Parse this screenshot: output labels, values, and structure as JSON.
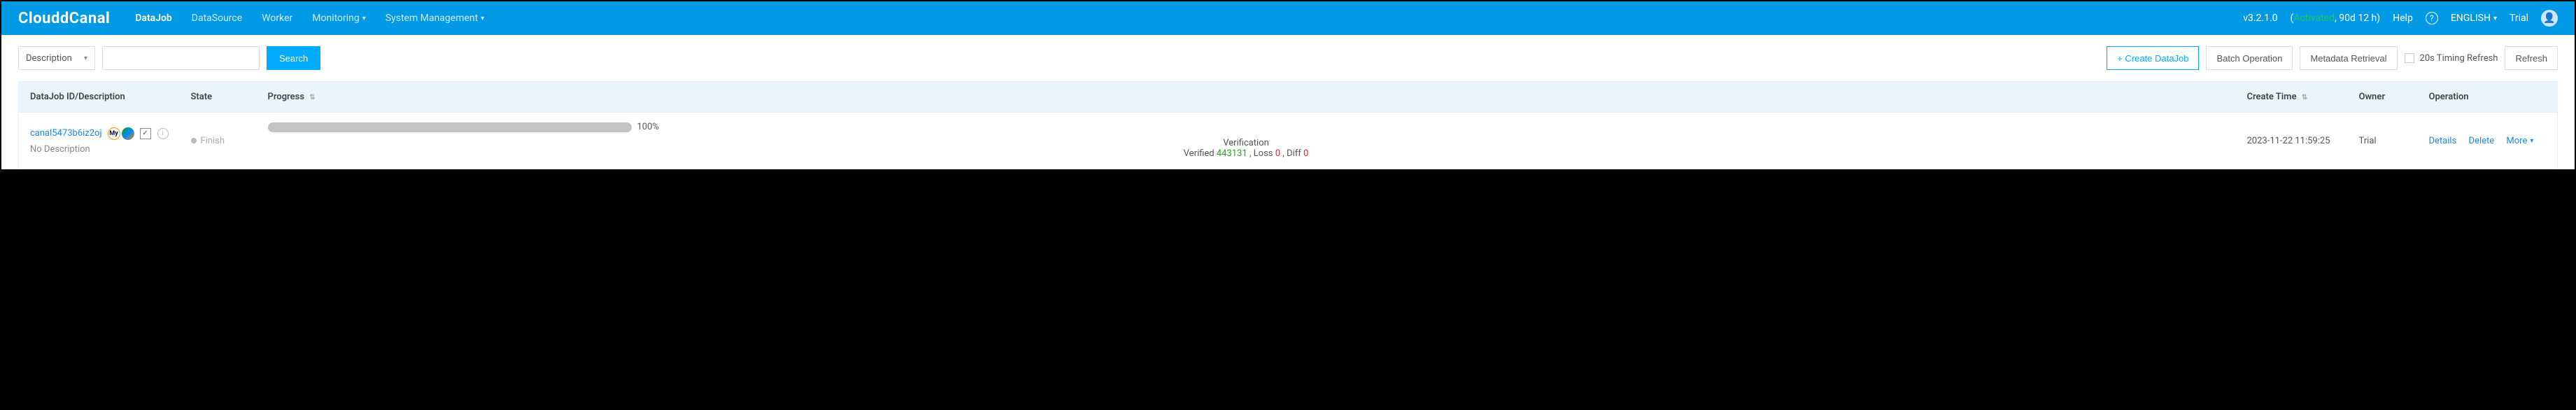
{
  "brand": "ClouddCanal",
  "nav": {
    "datajob": "DataJob",
    "datasource": "DataSource",
    "worker": "Worker",
    "monitoring": "Monitoring",
    "sysmgmt": "System Management"
  },
  "top_right": {
    "version": "v3.2.1.0",
    "license_open": "(",
    "license_status": "Activated",
    "license_sep": ", ",
    "license_duration": "90d 12 h",
    "license_close": ")",
    "help": "Help",
    "language": "ENGLISH",
    "user": "Trial"
  },
  "actions": {
    "desc_select": "Description",
    "search_value": "",
    "search_btn": "Search",
    "create": "+ Create DataJob",
    "batch": "Batch Operation",
    "metadata": "Metadata Retrieval",
    "timing_refresh": "20s Timing Refresh",
    "refresh": "Refresh"
  },
  "columns": {
    "id": "DataJob ID/Description",
    "state": "State",
    "progress": "Progress",
    "create_time": "Create Time",
    "owner": "Owner",
    "operation": "Operation"
  },
  "row": {
    "id": "canal5473b6iz2oj",
    "desc": "No Description",
    "source_db": "MySQL",
    "state": "Finish",
    "progress_pct": "100%",
    "progress_title": "Verification",
    "progress_prefix": "Verified ",
    "progress_verified": "443131",
    "progress_loss_label": " , Loss ",
    "progress_loss": "0",
    "progress_diff_label": " , Diff ",
    "progress_diff": "0",
    "create_time": "2023-11-22 11:59:25",
    "owner": "Trial",
    "op_details": "Details",
    "op_delete": "Delete",
    "op_more": "More"
  }
}
